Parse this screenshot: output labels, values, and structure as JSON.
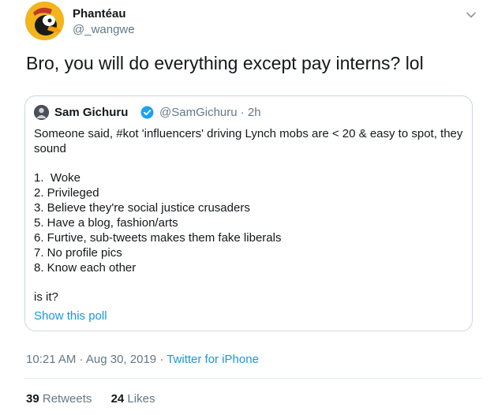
{
  "tweet": {
    "author_name": "Phantéau",
    "author_handle": "@_wangwe",
    "text": "Bro, you will do everything except pay interns? lol"
  },
  "quoted": {
    "author_name": "Sam Gichuru",
    "author_handle_time": "@SamGichuru · 2h",
    "lines": [
      "Someone said, #kot 'influencers' driving Lynch mobs are < 20 & easy to spot, they",
      "sound",
      "",
      "1.  Woke",
      "2. Privileged",
      "3. Believe they're social justice crusaders",
      "5. Have a blog, fashion/arts",
      "6. Furtive, sub-tweets makes them fake liberals",
      "7. No profile pics",
      "8. Know each other",
      "",
      "is it?"
    ],
    "poll_link": "Show this poll"
  },
  "meta": {
    "timestamp": "10:21 AM · Aug 30, 2019 · ",
    "source": "Twitter for iPhone"
  },
  "stats": {
    "retweets_count": "39",
    "retweets_label": "Retweets",
    "likes_count": "24",
    "likes_label": "Likes"
  },
  "colors": {
    "link": "#1b95e0",
    "secondary_text": "#657786",
    "border": "#ccd6dd",
    "verified": "#1da1f2"
  }
}
